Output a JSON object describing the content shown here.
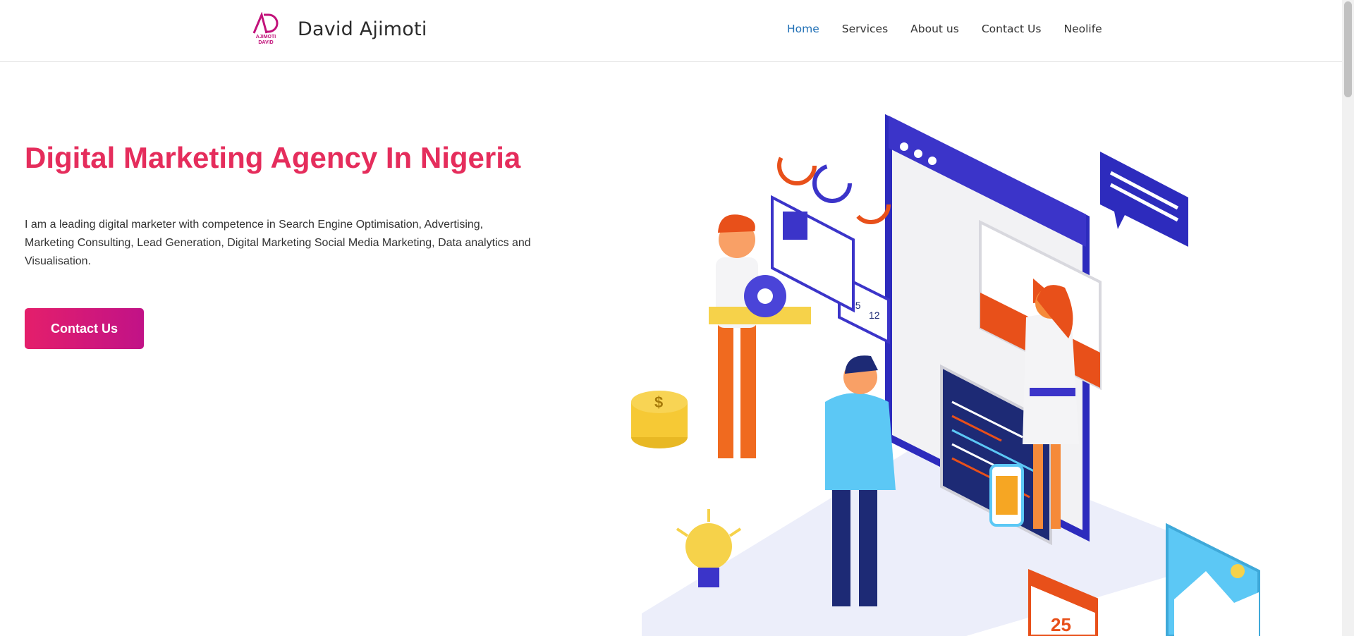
{
  "header": {
    "logo_text": "AJIMOTI DAVID",
    "title": "David Ajimoti"
  },
  "nav": {
    "items": [
      "Home",
      "Services",
      "About us",
      "Contact Us",
      "Neolife"
    ],
    "active": "Home"
  },
  "hero": {
    "title": "Digital Marketing Agency In Nigeria",
    "text": "I am a leading digital marketer with competence in Search Engine Optimisation, Advertising, Marketing Consulting, Lead Generation, Digital Marketing Social Media Marketing, Data analytics and Visualisation.",
    "cta_label": "Contact Us"
  },
  "illustration": {
    "likes": "25",
    "comments": "12",
    "calendar_day": "25",
    "coin_symbol": "$"
  },
  "colors": {
    "accent": "#e52d5c",
    "nav_active": "#1f6fb5",
    "cta_start": "#e41f6b",
    "cta_end": "#c11287"
  }
}
